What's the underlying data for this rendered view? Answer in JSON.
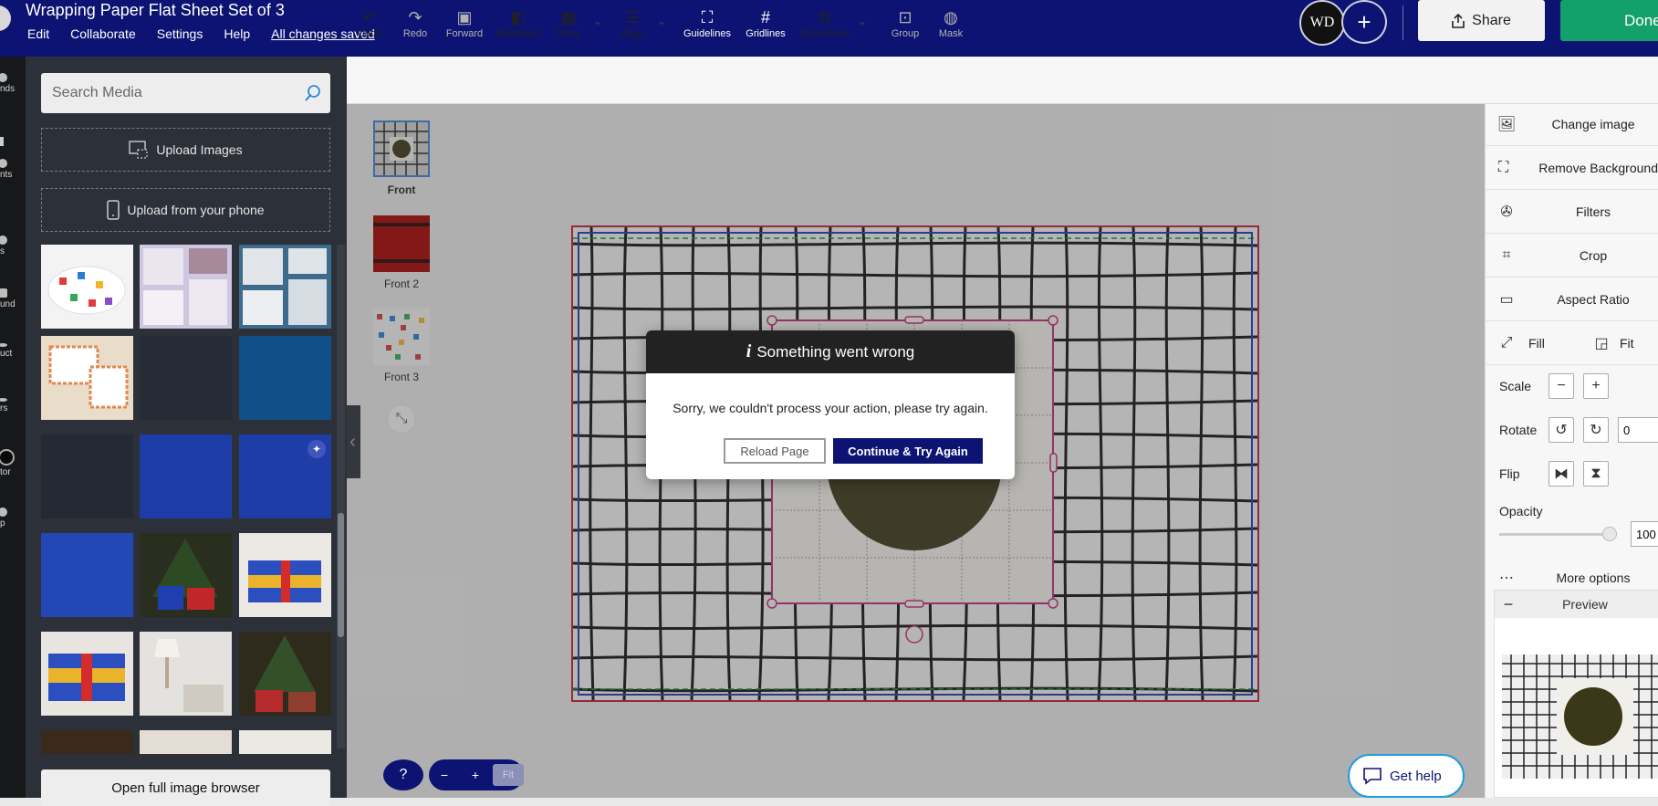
{
  "header": {
    "title": "Wrapping Paper Flat Sheet Set of 3",
    "menu": [
      "Edit",
      "Collaborate",
      "Settings",
      "Help"
    ],
    "saved_status": "All changes saved",
    "avatar_text": "WD",
    "share_label": "Share",
    "done_label": "Done"
  },
  "left_rail": [
    "nds",
    "nts",
    "s",
    "und",
    "uct",
    "rs",
    "tor",
    "p"
  ],
  "media": {
    "search_placeholder": "Search Media",
    "upload_images": "Upload Images",
    "upload_phone": "Upload from your phone",
    "open_browser": "Open full image browser"
  },
  "toolbar": {
    "undo": "Undo",
    "redo": "Redo",
    "forward": "Forward",
    "backward": "Backward",
    "tiling": "Tiling",
    "align": "Align",
    "guidelines": "Guidelines",
    "gridlines": "Gridlines",
    "orientation": "Orientation",
    "group": "Group",
    "mask": "Mask"
  },
  "pages": [
    "Front",
    "Front 2",
    "Front 3"
  ],
  "dialog": {
    "title": "Something went wrong",
    "info_glyph": "i",
    "message": "Sorry, we couldn't process your action, please try again.",
    "reload": "Reload Page",
    "continue": "Continue & Try Again"
  },
  "zoom": {
    "help_glyph": "?",
    "minus": "−",
    "plus": "+",
    "fit": "Fit"
  },
  "get_help": "Get help",
  "right_panel": {
    "change_image": "Change image",
    "remove_background": "Remove Background",
    "filters": "Filters",
    "crop": "Crop",
    "aspect_ratio": "Aspect Ratio",
    "fill": "Fill",
    "fit": "Fit",
    "scale": "Scale",
    "rotate": "Rotate",
    "rotate_value": "0",
    "flip": "Flip",
    "opacity": "Opacity",
    "opacity_value": "100",
    "more_options": "More options",
    "preview": "Preview"
  },
  "colors": {
    "brand": "#0d1372",
    "done": "#14a06a",
    "selection": "#c01b3d"
  }
}
